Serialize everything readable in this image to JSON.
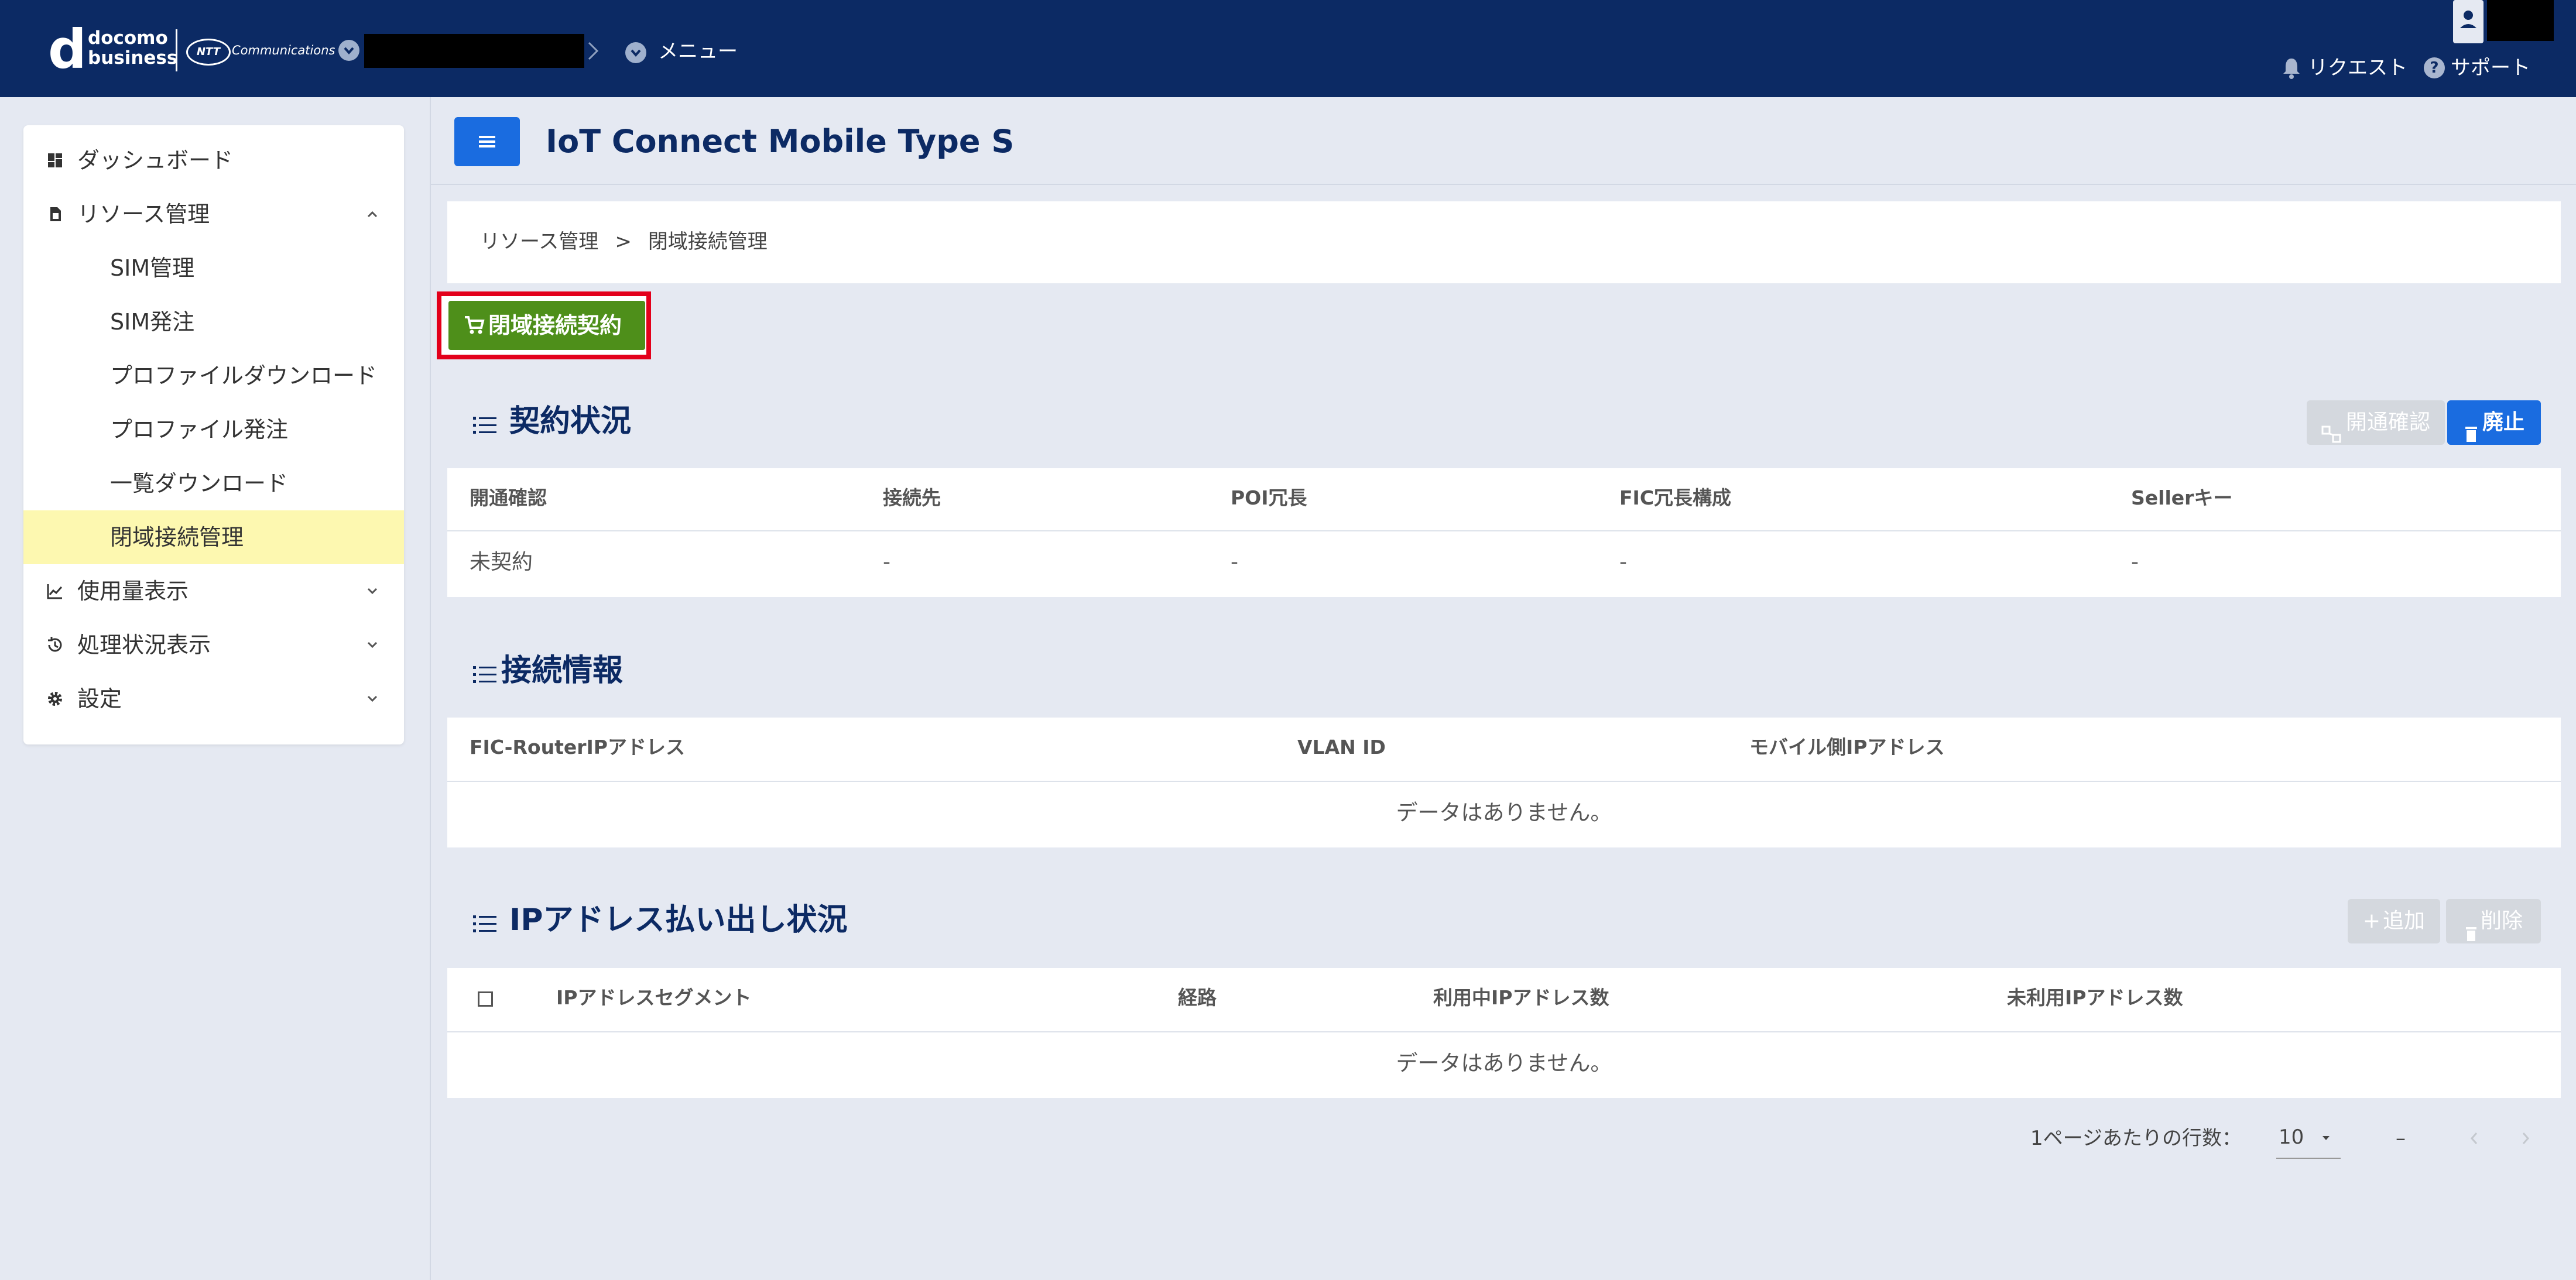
{
  "header": {
    "brand_line1": "docomo",
    "brand_line2": "business",
    "ntt_badge": "NTT",
    "ntt_text": "Communications",
    "menu_label": "メニュー",
    "request_label": "リクエスト",
    "support_label": "サポート"
  },
  "sidebar": {
    "items": [
      {
        "label": "ダッシュボード"
      },
      {
        "label": "リソース管理"
      },
      {
        "label": "SIM管理"
      },
      {
        "label": "SIM発注"
      },
      {
        "label": "プロファイルダウンロード"
      },
      {
        "label": "プロファイル発注"
      },
      {
        "label": "一覧ダウンロード"
      },
      {
        "label": "閉域接続管理"
      },
      {
        "label": "使用量表示"
      },
      {
        "label": "処理状況表示"
      },
      {
        "label": "設定"
      }
    ]
  },
  "page": {
    "title": "IoT Connect Mobile Type S",
    "breadcrumb": {
      "parent": "リソース管理",
      "separator": ">",
      "current": "閉域接続管理"
    },
    "contract_button": "閉域接続契約"
  },
  "contract_section": {
    "title": "契約状況",
    "open_check_button": "開通確認",
    "abolish_button": "廃止",
    "columns": [
      "開通確認",
      "接続先",
      "POI冗長",
      "FIC冗長構成",
      "Sellerキー"
    ],
    "row": [
      "未契約",
      "-",
      "-",
      "-",
      "-"
    ]
  },
  "connection_section": {
    "title": "接続情報",
    "columns": [
      "FIC-RouterIPアドレス",
      "VLAN ID",
      "モバイル側IPアドレス"
    ],
    "empty_text": "データはありません。"
  },
  "ip_section": {
    "title": "IPアドレス払い出し状況",
    "add_button": "追加",
    "delete_button": "削除",
    "columns": [
      "IPアドレスセグメント",
      "経路",
      "利用中IPアドレス数",
      "未利用IPアドレス数"
    ],
    "empty_text": "データはありません。"
  },
  "pagination": {
    "rows_per_page_label": "1ページあたりの行数：",
    "rows_per_page_value": "10",
    "range_text": "–"
  },
  "colors": {
    "header_bg": "#0c2a64",
    "primary_blue": "#1a6ce0",
    "contract_green": "#4e8f1a",
    "highlight_red": "#e3001b",
    "active_item_bg": "#fdf8b0"
  }
}
